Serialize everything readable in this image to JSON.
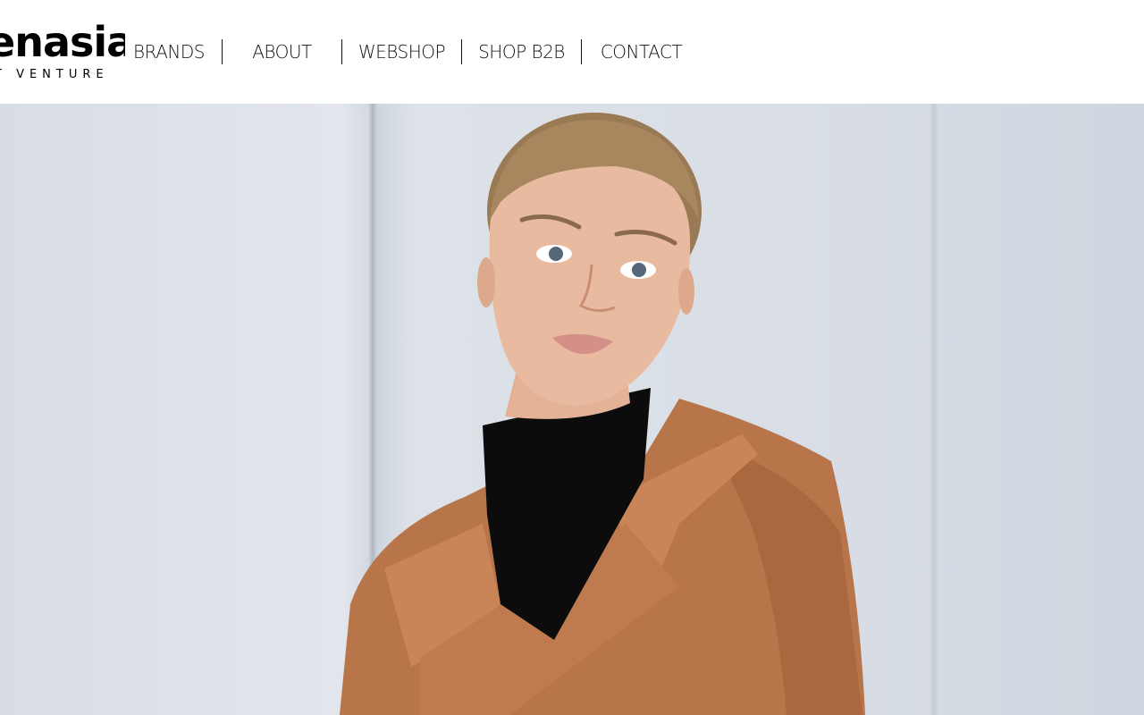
{
  "logo": {
    "wordmark": "enasia",
    "tagline": "T VENTURE"
  },
  "nav": {
    "items": [
      {
        "label": "BRANDS"
      },
      {
        "label": "ABOUT"
      },
      {
        "label": "WEBSHOP"
      },
      {
        "label": "SHOP B2B"
      },
      {
        "label": "CONTACT"
      }
    ]
  },
  "hero": {
    "image_subject": "fashion-model-leather-coat-photo",
    "colors": {
      "backdrop": "#dde2e8",
      "coat": "#b9754a",
      "turtleneck": "#0c0c0c",
      "skin": "#e8bba0",
      "hair": "#9a7a55"
    }
  }
}
